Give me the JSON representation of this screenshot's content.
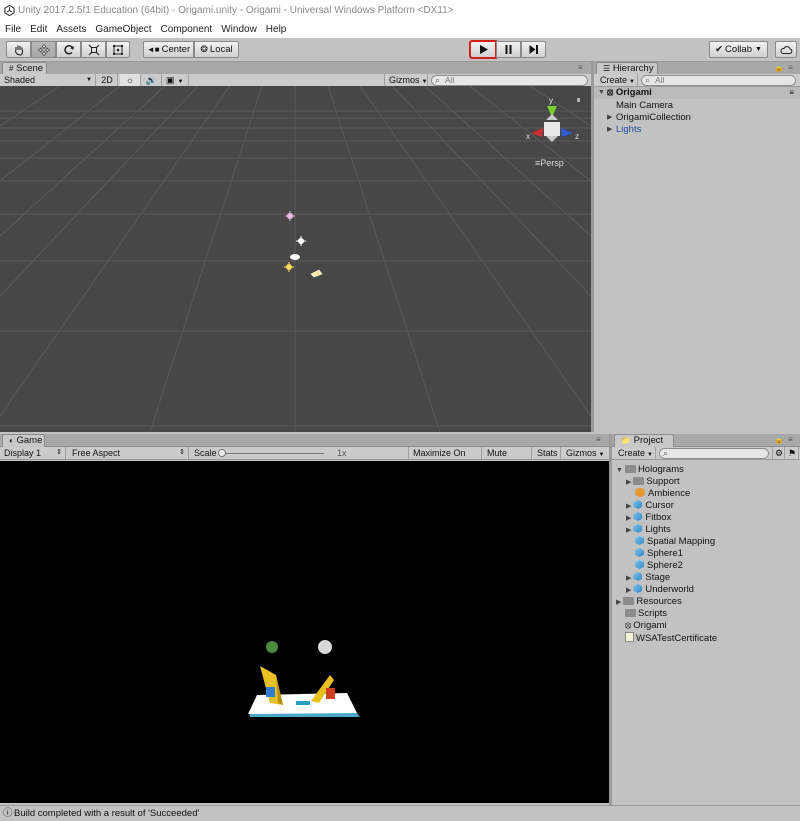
{
  "window": {
    "title": "Unity 2017.2.5f1 Education (64bit) - Origami.unity - Origami - Universal Windows Platform <DX11>"
  },
  "menu": [
    "File",
    "Edit",
    "Assets",
    "GameObject",
    "Component",
    "Window",
    "Help"
  ],
  "toolbar": {
    "pivot_label": "Center",
    "space_label": "Local",
    "collab_label": "Collab",
    "tools": [
      "hand-tool",
      "move-tool",
      "rotate-tool",
      "scale-tool",
      "rect-tool"
    ],
    "playback": [
      "play",
      "pause",
      "step"
    ]
  },
  "scene": {
    "tab_label": "Scene",
    "shading": "Shaded",
    "mode_2d": "2D",
    "gizmos_label": "Gizmos",
    "search_placeholder": "All",
    "persp_label": "Persp",
    "axis_y": "y",
    "axis_x": "x",
    "axis_z": "z"
  },
  "hierarchy": {
    "tab_label": "Hierarchy",
    "create_label": "Create",
    "search_placeholder": "All",
    "root": "Origami",
    "items": [
      "Main Camera",
      "OrigamiCollection",
      "Lights"
    ]
  },
  "game": {
    "tab_label": "Game",
    "display": "Display 1",
    "aspect": "Free Aspect",
    "scale_label": "Scale",
    "scale_value": "1x",
    "scale_level": 0,
    "toggles": [
      "Maximize On Play",
      "Mute Audio",
      "Stats",
      "Gizmos"
    ]
  },
  "project": {
    "tab_label": "Project",
    "create_label": "Create",
    "items": [
      {
        "label": "Holograms",
        "icon": "folder-open-icon"
      },
      {
        "label": "Support",
        "icon": "folder-icon"
      },
      {
        "label": "Ambience",
        "icon": "audio-icon"
      },
      {
        "label": "Cursor",
        "icon": "prefab-icon"
      },
      {
        "label": "Fitbox",
        "icon": "prefab-icon"
      },
      {
        "label": "Lights",
        "icon": "prefab-icon"
      },
      {
        "label": "Spatial Mapping",
        "icon": "prefab-icon"
      },
      {
        "label": "Sphere1",
        "icon": "prefab-icon"
      },
      {
        "label": "Sphere2",
        "icon": "prefab-icon"
      },
      {
        "label": "Stage",
        "icon": "prefab-icon"
      },
      {
        "label": "Underworld",
        "icon": "prefab-icon"
      },
      {
        "label": "Resources",
        "icon": "folder-icon"
      },
      {
        "label": "Scripts",
        "icon": "folder-icon"
      },
      {
        "label": "Origami",
        "icon": "unity-scene-icon"
      },
      {
        "label": "WSATestCertificate",
        "icon": "certificate-icon"
      }
    ]
  },
  "status": {
    "message": "Build completed with a result of 'Succeeded'"
  },
  "colors": {
    "play_highlight": "#d0201a",
    "lights_text": "#1f4fa8",
    "scene_bg": "#474747"
  }
}
